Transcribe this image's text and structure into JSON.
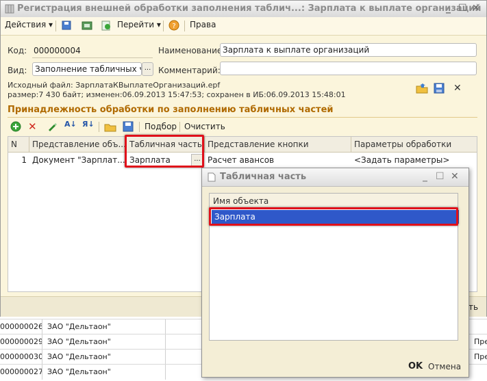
{
  "main_window": {
    "title": "Регистрация внешней обработки заполнения таблич...: Зарплата к выплате организаций",
    "toolbar": {
      "actions_label": "Действия",
      "goto_label": "Перейти",
      "rights_label": "Права"
    },
    "code_label": "Код:",
    "code_value": "000000004",
    "name_label": "Наименование:",
    "name_value": "Зарплата к выплате организаций",
    "type_label": "Вид:",
    "type_value": "Заполнение табличных час",
    "comment_label": "Комментарий:",
    "comment_value": "",
    "source_file_line1": "Исходный файл: ЗарплатаКВыплатеОрганизаций.epf",
    "source_file_line2": "размер:7 430 байт; изменен:06.09.2013 15:47:53; сохранен в ИБ:06.09.2013 15:48:01",
    "section_title": "Принадлежность обработки по заполнению табличных частей",
    "grid_toolbar": {
      "select_label": "Подбор",
      "clear_label": "Очистить"
    },
    "grid": {
      "columns": [
        "N",
        "Представление объ...",
        "Табличная часть",
        "Представление кнопки",
        "Параметры обработки"
      ],
      "rows": [
        {
          "n": "1",
          "object": "Документ \"Зарплат...",
          "tabular": "Зарплата",
          "button": "Расчет авансов",
          "params": "<Задать параметры>"
        }
      ]
    },
    "bottom_right_text": "ть"
  },
  "popup": {
    "title": "Табличная часть",
    "column_header": "Имя объекта",
    "selected_item": "Зарплата",
    "ok_label": "OK",
    "cancel_label": "Отмена"
  },
  "background_list": {
    "rows": [
      {
        "code": "000000026",
        "name": "ЗАО \"Дельтаон\"",
        "extra": ""
      },
      {
        "code": "000000029",
        "name": "ЗАО \"Дельтаон\"",
        "extra": "Пре"
      },
      {
        "code": "000000030",
        "name": "ЗАО \"Дельтаон\"",
        "extra": "Пре"
      },
      {
        "code": "000000027",
        "name": "ЗАО \"Дельтаон\"",
        "extra": ""
      }
    ]
  },
  "colors": {
    "window_bg": "#fbf5dc",
    "section_title": "#b06a00",
    "highlight_red": "#e0101a",
    "selection_blue": "#2f58c9"
  }
}
